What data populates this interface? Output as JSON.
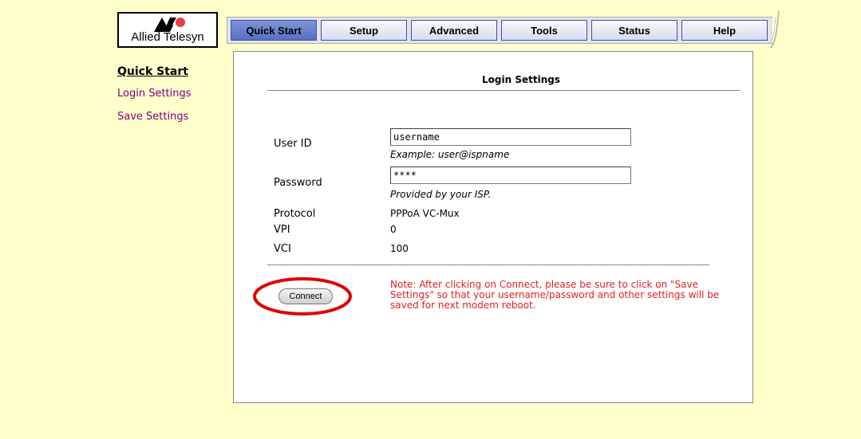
{
  "logo": {
    "text": "Allied Telesyn",
    "icon": "allied-telesyn-logo-icon"
  },
  "tabs": [
    {
      "label": "Quick Start",
      "active": true
    },
    {
      "label": "Setup",
      "active": false
    },
    {
      "label": "Advanced",
      "active": false
    },
    {
      "label": "Tools",
      "active": false
    },
    {
      "label": "Status",
      "active": false
    },
    {
      "label": "Help",
      "active": false
    }
  ],
  "sidebar": {
    "title": "Quick Start",
    "items": [
      {
        "label": "Login Settings"
      },
      {
        "label": "Save Settings"
      }
    ]
  },
  "panel": {
    "title": "Login Settings",
    "user_id": {
      "label": "User ID",
      "value": "username",
      "hint": "Example: user@ispname"
    },
    "password": {
      "label": "Password",
      "value": "****",
      "hint": "Provided by your ISP."
    },
    "protocol": {
      "label": "Protocol",
      "value": "PPPoA VC-Mux"
    },
    "vpi": {
      "label": "VPI",
      "value": "0"
    },
    "vci": {
      "label": "VCI",
      "value": "100"
    },
    "connect_label": "Connect",
    "note": "Note: After clicking on Connect, please be sure to click on \"Save Settings\" so that your username/password and other settings will be saved for next modem reboot."
  },
  "colors": {
    "page_background": "#ffffcc",
    "active_tab": "#6a80cc",
    "link": "#800080",
    "note_text": "#e02020",
    "highlight_ellipse": "#e00000"
  }
}
